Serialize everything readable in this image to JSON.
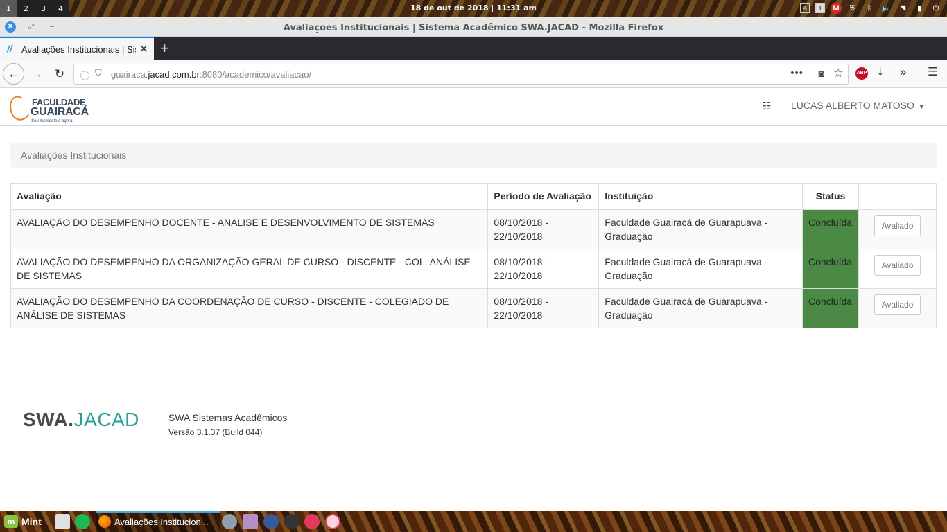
{
  "desktop": {
    "workspaces": [
      "1",
      "2",
      "3",
      "4"
    ],
    "clock": "18 de out de 2018 | 11:31 am",
    "tray": {
      "kbd": "A",
      "badge": "1"
    }
  },
  "window": {
    "title": "Avaliações Institucionais | Sistema Acadêmico SWA.JACAD - Mozilla Firefox"
  },
  "browser": {
    "tab_label": "Avaliações Institucionais | Sis",
    "url_host_pre": "guairaca.",
    "url_host": "jacad.com.br",
    "url_rest": ":8080/academico/avaliacao/",
    "abp": "ABP"
  },
  "header": {
    "logo_line1": "FACULDADE",
    "logo_line2": "GUAIRACÁ",
    "logo_tagline": "Seu momento é agora.",
    "user_name": "LUCAS ALBERTO MATOSO"
  },
  "breadcrumb": "Avaliações Institucionais",
  "table": {
    "headers": {
      "avaliacao": "Avaliação",
      "periodo": "Período de Avaliação",
      "instituicao": "Instituição",
      "status": "Status"
    },
    "rows": [
      {
        "avaliacao": "AVALIAÇÃO DO DESEMPENHO DOCENTE - ANÁLISE E DESENVOLVIMENTO DE SISTEMAS",
        "periodo": "08/10/2018 - 22/10/2018",
        "instituicao": "Faculdade Guairacá de Guarapuava - Graduação",
        "status": "Concluída",
        "action": "Avaliado"
      },
      {
        "avaliacao": "AVALIAÇÃO DO DESEMPENHO DA ORGANIZAÇÃO GERAL DE CURSO - DISCENTE - COL. ANÁLISE DE SISTEMAS",
        "periodo": "08/10/2018 - 22/10/2018",
        "instituicao": "Faculdade Guairacá de Guarapuava - Graduação",
        "status": "Concluída",
        "action": "Avaliado"
      },
      {
        "avaliacao": "AVALIAÇÃO DO DESEMPENHO DA COORDENAÇÃO DE CURSO - DISCENTE - COLEGIADO DE ANÁLISE DE SISTEMAS",
        "periodo": "08/10/2018 - 22/10/2018",
        "instituicao": "Faculdade Guairacá de Guarapuava - Graduação",
        "status": "Concluída",
        "action": "Avaliado"
      }
    ]
  },
  "footer": {
    "logo_a": "SWA.",
    "logo_b": "JACAD",
    "title": "SWA Sistemas Acadêmicos",
    "version": "Versão 3.1.37 (Build 044)"
  },
  "taskbar": {
    "menu_label": "Mint",
    "window_label": "Avaliações Institucion..."
  },
  "colors": {
    "status_done": "#4a8a45",
    "tab_accent": "#0a84ff"
  }
}
